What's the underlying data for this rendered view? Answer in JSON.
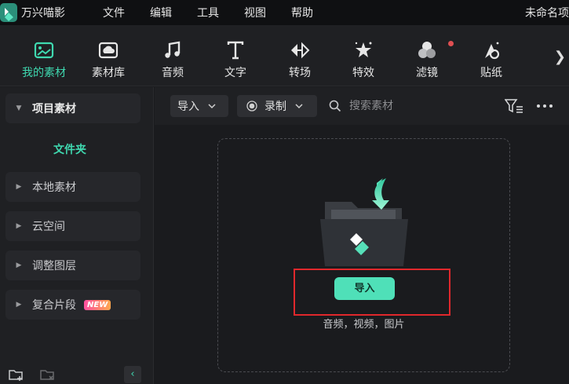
{
  "app": {
    "name": "万兴喵影",
    "project_title": "未命名项"
  },
  "menu": [
    "文件",
    "编辑",
    "工具",
    "视图",
    "帮助"
  ],
  "toolbar": {
    "tools": [
      {
        "label": "我的素材",
        "icon": "my-media-icon",
        "active": true
      },
      {
        "label": "素材库",
        "icon": "media-library-icon"
      },
      {
        "label": "音频",
        "icon": "music-note-icon"
      },
      {
        "label": "文字",
        "icon": "text-t-icon"
      },
      {
        "label": "转场",
        "icon": "transition-icon"
      },
      {
        "label": "特效",
        "icon": "effects-star-icon"
      },
      {
        "label": "滤镜",
        "icon": "filter-icon",
        "notification_dot": true
      },
      {
        "label": "贴纸",
        "icon": "sticker-icon"
      }
    ],
    "more_glyph": "❯"
  },
  "sidebar": {
    "project_media": "项目素材",
    "folder": "文件夹",
    "local_media": "本地素材",
    "cloud": "云空间",
    "adjust_layer": "调整图层",
    "compound_clip": "复合片段",
    "new_badge": "NEW",
    "collapse_glyph": "‹"
  },
  "filterbar": {
    "import_dropdown": "导入",
    "record_dropdown": "录制",
    "search_placeholder": "搜索素材"
  },
  "dropzone": {
    "import_button": "导入",
    "hint": "音频，视频，图片"
  },
  "colors": {
    "accent": "#3fd9b0",
    "button": "#4fe0b8",
    "highlight": "#e0282c",
    "dot": "#e04f52"
  }
}
